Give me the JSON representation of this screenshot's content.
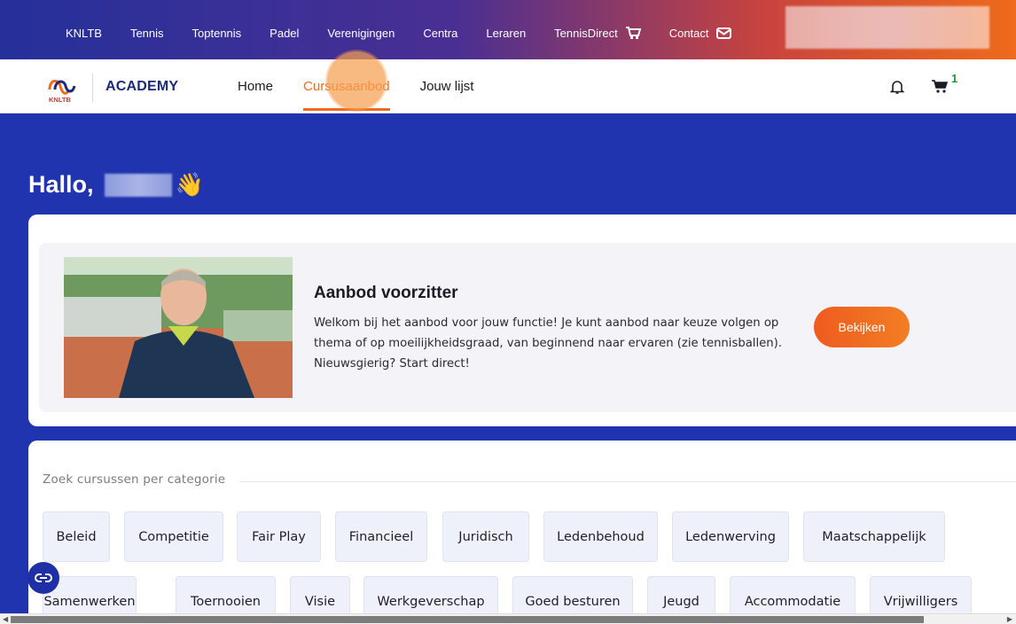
{
  "topnav": {
    "items": [
      "KNLTB",
      "Tennis",
      "Toptennis",
      "Padel",
      "Verenigingen",
      "Centra",
      "Leraren",
      "TennisDirect",
      "Contact"
    ]
  },
  "header": {
    "logo_text": "KNLTB",
    "brand": "ACADEMY",
    "menu": [
      "Home",
      "Cursusaanbod",
      "Jouw lijst"
    ],
    "active_menu": "Cursusaanbod",
    "cart_count": "1"
  },
  "hero": {
    "greeting": "Hallo,",
    "wave": "👋"
  },
  "feature": {
    "title": "Aanbod voorzitter",
    "text": "Welkom bij het aanbod voor jouw functie! Je kunt aanbod naar keuze volgen op thema of op moeilijkheidsgraad, van beginnend naar ervaren (zie tennisballen). Nieuwsgierig? Start direct!",
    "button": "Bekijken"
  },
  "categories": {
    "header": "Zoek cursussen per categorie",
    "row1": [
      "Beleid",
      "Competitie",
      "Fair Play",
      "Financieel",
      "Juridisch",
      "Ledenbehoud",
      "Ledenwerving",
      "Maatschappelijk"
    ],
    "row2": [
      "Samenwerken",
      "Toernooien",
      "Visie",
      "Werkgeverschap",
      "Goed besturen",
      "Jeugd",
      "Accommodatie",
      "Vrijwilligers"
    ]
  },
  "colors": {
    "primary_blue": "#2034b0",
    "accent_orange": "#ef6a1b",
    "cart_badge": "#1b9a3a"
  }
}
